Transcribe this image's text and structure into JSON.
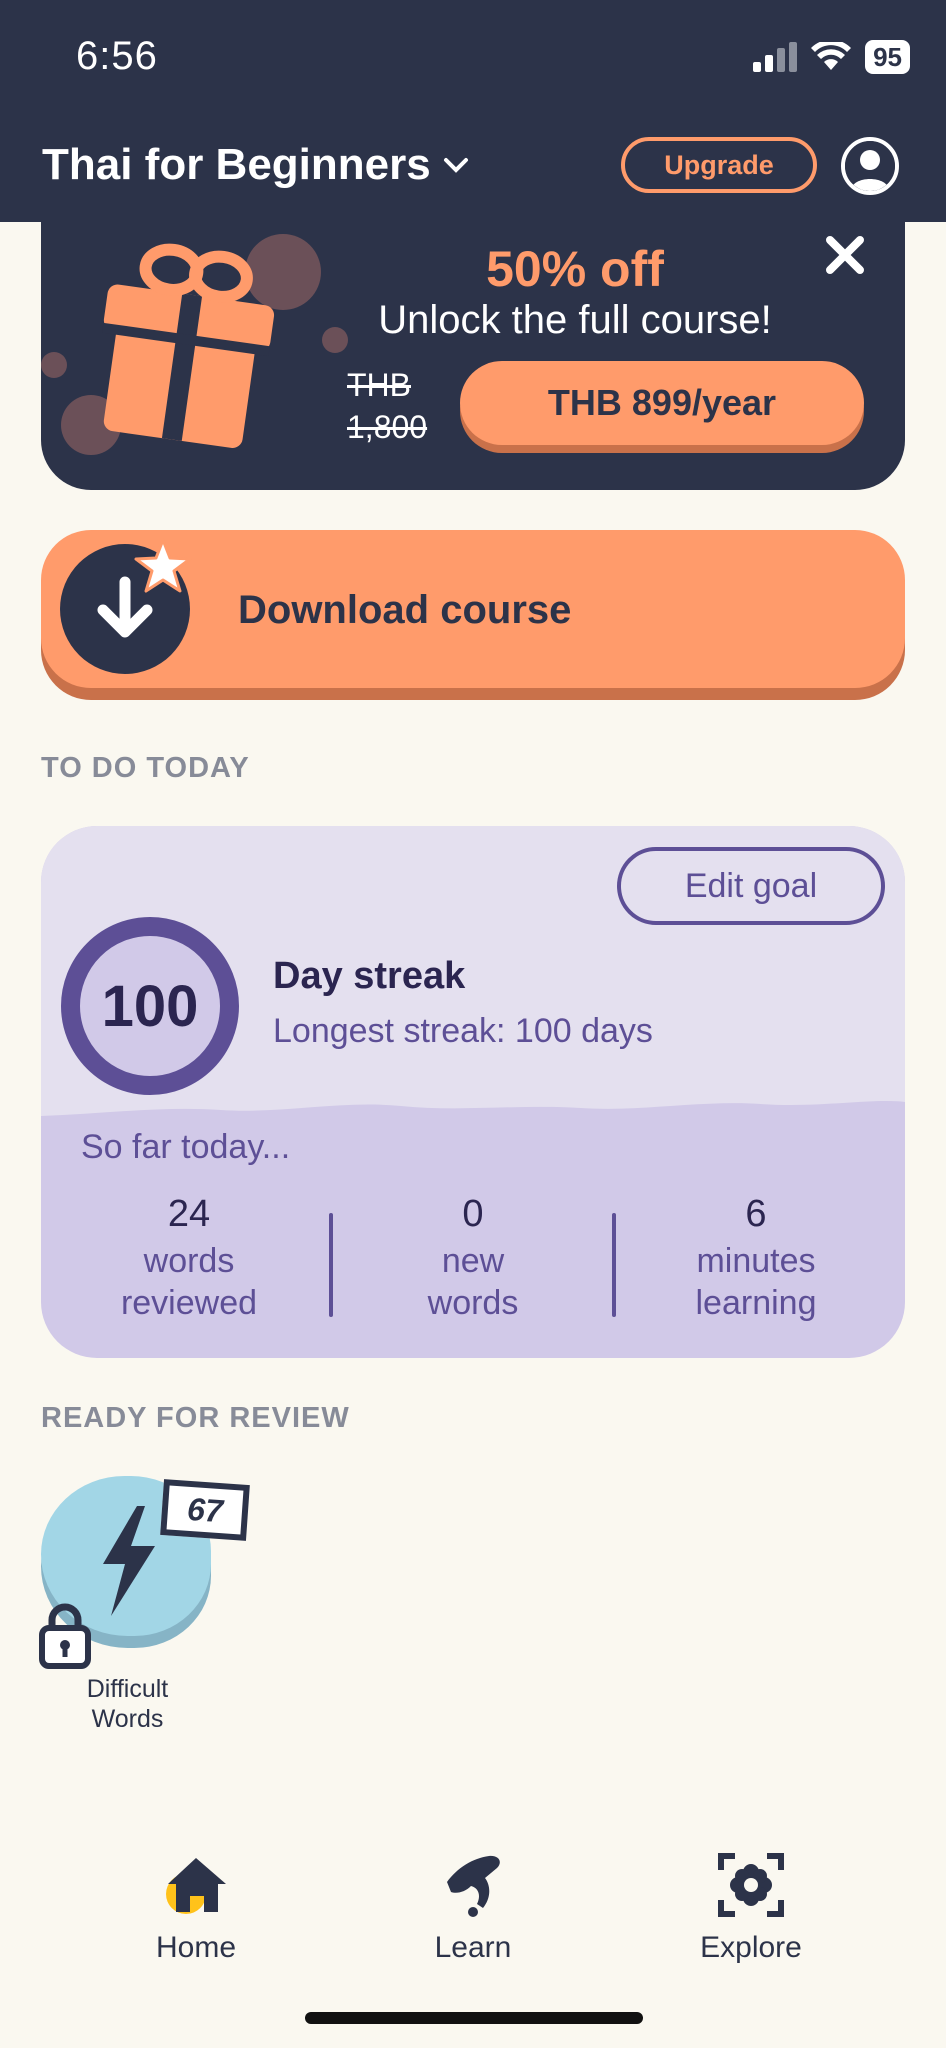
{
  "status_bar": {
    "time": "6:56",
    "battery": "95"
  },
  "header": {
    "course_title": "Thai for Beginners",
    "upgrade_label": "Upgrade"
  },
  "promo": {
    "discount": "50% off",
    "subtitle": "Unlock the full course!",
    "old_price_currency": "THB",
    "old_price_amount": "1,800",
    "price_button": "THB 899/year"
  },
  "download": {
    "label": "Download course"
  },
  "todo": {
    "section_label": "TO DO TODAY",
    "edit_goal": "Edit goal",
    "streak_count": "100",
    "streak_title": "Day streak",
    "streak_sub": "Longest streak: 100 days",
    "so_far": "So far today...",
    "stats": [
      {
        "number": "24",
        "line1": "words",
        "line2": "reviewed"
      },
      {
        "number": "0",
        "line1": "new",
        "line2": "words"
      },
      {
        "number": "6",
        "line1": "minutes",
        "line2": "learning"
      }
    ]
  },
  "review": {
    "section_label": "READY FOR REVIEW",
    "count": "67",
    "label_line1": "Difficult",
    "label_line2": "Words"
  },
  "bottom_nav": [
    {
      "label": "Home",
      "icon": "home-icon",
      "active": true
    },
    {
      "label": "Learn",
      "icon": "learn-hand-icon",
      "active": false
    },
    {
      "label": "Explore",
      "icon": "explore-icon",
      "active": false
    }
  ],
  "colors": {
    "navy": "#2c3349",
    "accent_orange": "#ff9b6b",
    "lavender": "#d1c9e8",
    "purple": "#5d4f96",
    "review_blue": "#a2d6e6",
    "background": "#faf8f0"
  }
}
